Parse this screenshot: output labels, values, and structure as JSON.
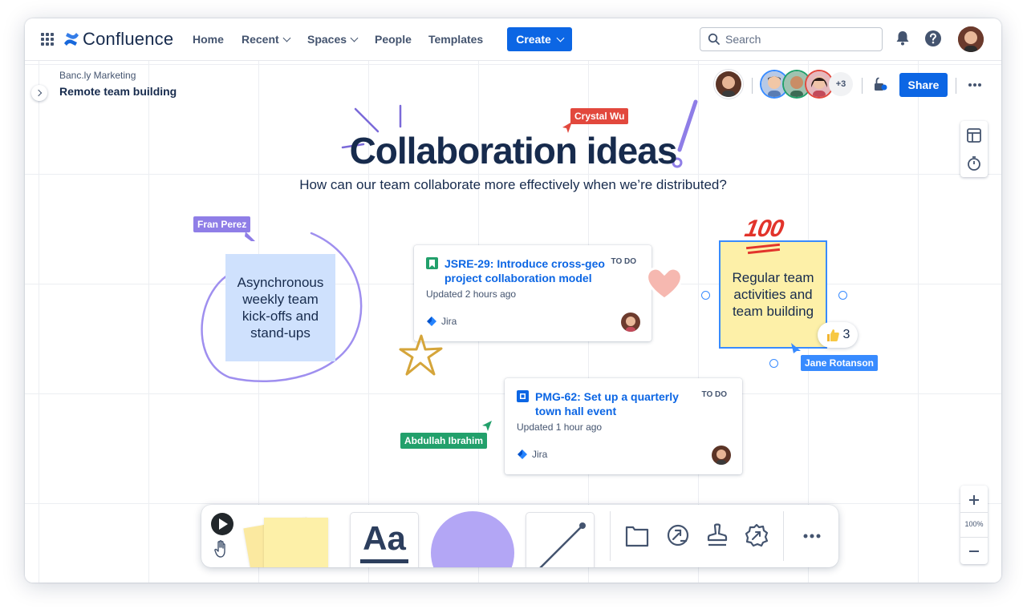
{
  "nav": {
    "app_name": "Confluence",
    "items": [
      "Home",
      "Recent",
      "Spaces",
      "People",
      "Templates"
    ],
    "create_label": "Create",
    "search_placeholder": "Search"
  },
  "breadcrumb": {
    "space": "Banc.ly Marketing",
    "page": "Remote team building"
  },
  "collaborators": {
    "more_count": "+3"
  },
  "share_label": "Share",
  "whiteboard": {
    "title": "Collaboration ideas",
    "subtitle": "How can our team collaborate more effectively when we’re distributed?",
    "cursors": {
      "crystal": "Crystal Wu",
      "fran": "Fran Perez",
      "jane": "Jane Rotanson",
      "abdullah": "Abdullah Ibrahim"
    },
    "sticky_blue": {
      "lines": [
        "Asynchronous",
        "weekly team",
        "kick-offs and",
        "stand-ups"
      ]
    },
    "sticky_yellow": {
      "lines": [
        "Regular team",
        "activities and",
        "team building"
      ]
    },
    "emoji_100": "100",
    "reaction": {
      "emoji": "thumbs-up",
      "count": "3"
    },
    "cards": [
      {
        "title": "JSRE-29: Introduce cross-geo project collaboration model",
        "status": "TO DO",
        "updated": "Updated 2 hours ago",
        "app": "Jira",
        "icon_color": "#22a06b"
      },
      {
        "title": "PMG-62: Set up a quarterly town hall event",
        "status": "TO DO",
        "updated": "Updated 1 hour ago",
        "app": "Jira",
        "icon_color": "#0c66e4"
      }
    ]
  },
  "toolbar": {
    "text_tool_label": "Aa"
  },
  "zoom": {
    "level": "100%"
  },
  "colors": {
    "brand_blue": "#0c66e4",
    "sticky_blue": "#cfe1fd",
    "sticky_yellow": "#fdf0a8",
    "purple": "#9f8fef",
    "crystal_red": "#e2483d",
    "fran_purple": "#8f7ee7",
    "jane_blue": "#388bff",
    "abdullah_green": "#22a06b",
    "star_gold": "#d5a53a"
  }
}
